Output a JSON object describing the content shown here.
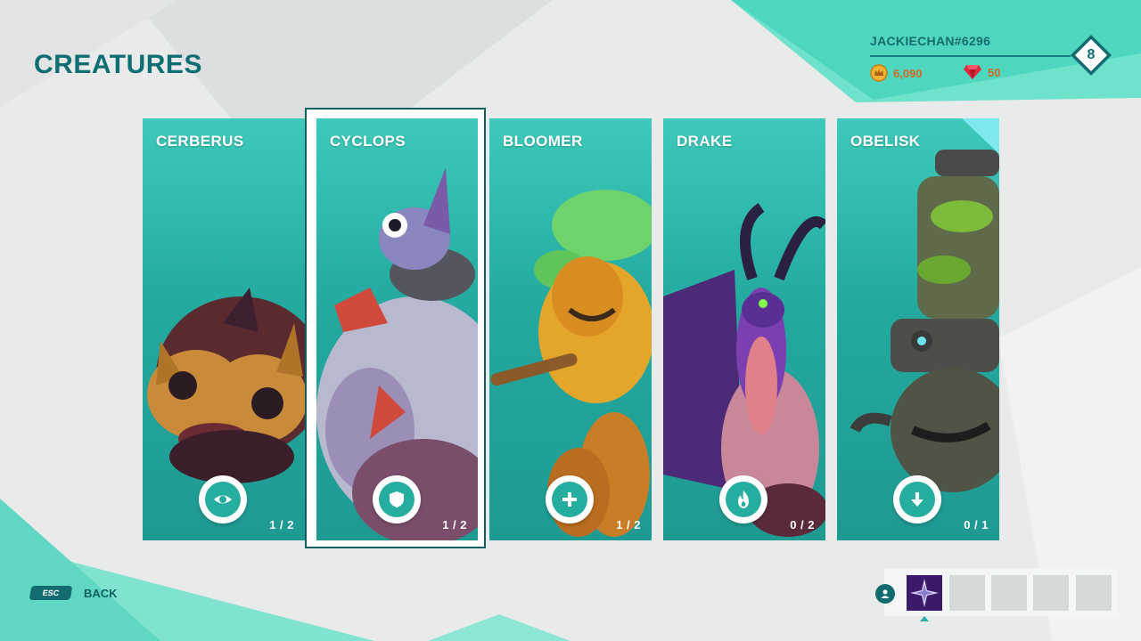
{
  "page": {
    "title": "CREATURES"
  },
  "profile": {
    "username": "JACKIECHAN#6296",
    "level": "8",
    "crowns": "6,090",
    "gems": "50"
  },
  "creatures": [
    {
      "name": "CERBERUS",
      "count": "1 / 2",
      "action_icon": "eye-icon"
    },
    {
      "name": "CYCLOPS",
      "count": "1 / 2",
      "action_icon": "shield-icon",
      "selected": true
    },
    {
      "name": "BLOOMER",
      "count": "1 / 2",
      "action_icon": "plus-icon"
    },
    {
      "name": "DRAKE",
      "count": "0 / 2",
      "action_icon": "flame-icon"
    },
    {
      "name": "OBELISK",
      "count": "0 / 1",
      "action_icon": "download-arrow-icon"
    }
  ],
  "footer": {
    "esc_key": "ESC",
    "back_label": "BACK"
  },
  "party": {
    "icon": "person-icon",
    "slots": [
      "compass-star-icon",
      "",
      "",
      "",
      ""
    ]
  },
  "colors": {
    "accent": "#136b70",
    "card_teal": "#25ad9f",
    "currency_orange": "#d2691e"
  }
}
